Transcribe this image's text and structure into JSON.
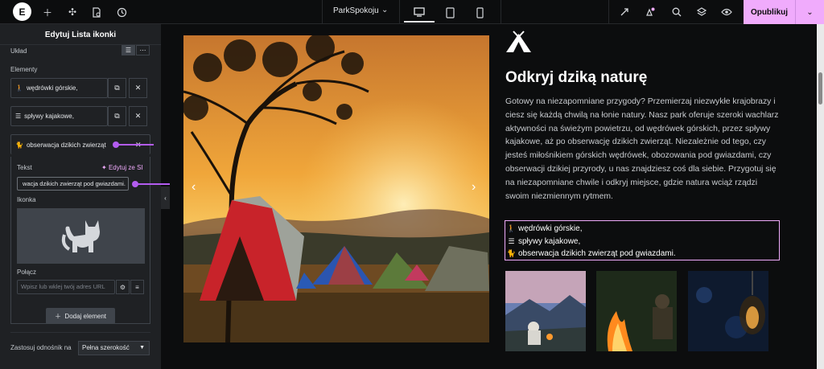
{
  "topbar": {
    "site_name": "ParkSpokoju",
    "publish_label": "Opublikuj"
  },
  "panel": {
    "title": "Edytuj Lista ikonki",
    "layout_label": "Układ",
    "elements_label": "Elementy",
    "items": [
      {
        "icon": "hiking-icon",
        "label": "wędrówki górskie,"
      },
      {
        "icon": "bars-icon",
        "label": "spływy kajakowe,"
      },
      {
        "icon": "cat-icon",
        "label": "obserwacja dzikich zwierząt"
      }
    ],
    "text_label": "Tekst",
    "ai_edit_label": "Edytuj ze SI",
    "text_value": "wacja dzikich zwierząt pod gwiazdami.",
    "icon_label": "Ikonka",
    "link_label": "Połącz",
    "link_placeholder": "Wpisz lub wklej twój adres URL",
    "add_label": "Dodaj element",
    "apply_link_label": "Zastosuj odnośnik na",
    "apply_link_value": "Pełna szerokość"
  },
  "content": {
    "heading": "Odkryj dziką naturę",
    "paragraph": "Gotowy na niezapomniane przygody? Przemierzaj niezwykłe krajobrazy i ciesz się każdą chwilą na łonie natury. Nasz park oferuje szeroki wachlarz aktywności na świeżym powietrzu, od wędrówek górskich, przez spływy kajakowe, aż po obserwację dzikich zwierząt. Niezależnie od tego, czy jesteś miłośnikiem górskich wędrówek, obozowania pod gwiazdami, czy obserwacji dzikiej przyrody, u nas znajdziesz coś dla siebie. Przygotuj się na niezapomniane chwile i odkryj miejsce, gdzie natura wciąż rządzi swoim niezmiennym rytmem.",
    "list": [
      {
        "icon": "hiking-icon",
        "label": "wędrówki górskie,"
      },
      {
        "icon": "bars-icon",
        "label": "spływy kajakowe,"
      },
      {
        "icon": "cat-icon",
        "label": "obserwacja dzikich zwierząt pod gwiazdami."
      }
    ]
  },
  "colors": {
    "accent": "#f0abfc",
    "annotation": "#b35cf0",
    "panel_bg": "#1f2124",
    "canvas_bg": "#0c0d0e"
  }
}
